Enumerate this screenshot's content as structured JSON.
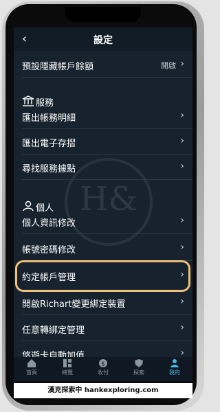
{
  "header": {
    "back_icon": "chevron-left-icon",
    "title": "設定"
  },
  "top_row": {
    "label": "預設隱藏帳戶餘額",
    "value": "開啟"
  },
  "section_services": {
    "icon": "bank-icon",
    "label": "服務"
  },
  "service_items": [
    {
      "label": "匯出帳務明細"
    },
    {
      "label": "匯出電子存摺"
    },
    {
      "label": "尋找服務據點"
    }
  ],
  "section_personal": {
    "icon": "person-icon",
    "label": "個人"
  },
  "personal_items": [
    {
      "label": "個人資訊修改"
    },
    {
      "label": "帳號密碼修改"
    },
    {
      "label": "約定帳戶管理"
    },
    {
      "label": "開啟Richart變更綁定裝置"
    },
    {
      "label": "任意轉綁定管理"
    },
    {
      "label": "悠遊卡自動加值"
    }
  ],
  "tabbar": [
    {
      "icon": "home-icon",
      "label": "首頁"
    },
    {
      "icon": "dashboard-icon",
      "label": "總覽"
    },
    {
      "icon": "dollar-icon",
      "label": "收付"
    },
    {
      "icon": "shield-icon",
      "label": "探索"
    },
    {
      "icon": "user-icon",
      "label": "我的"
    }
  ],
  "watermark_text": "H&",
  "caption": "漢克探索中 hankexploring.com",
  "colors": {
    "screen_bg": "#16222d",
    "highlight": "#f0c07a",
    "active_tab": "#46b8e5"
  }
}
